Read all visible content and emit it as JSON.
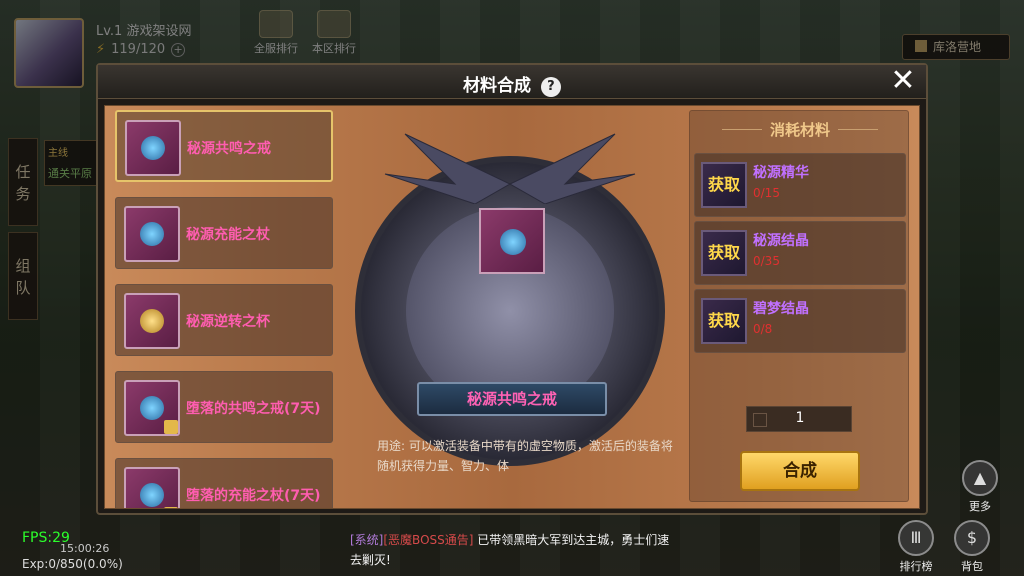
{
  "hud": {
    "level": "Lv.1",
    "player_name": "游戏架设网",
    "stamina": "119/120",
    "plus": "+",
    "rank_all": "全服排行",
    "rank_zone": "本区排行",
    "location": "库洛营地",
    "side_tab_task": "任务",
    "side_tab_team": "组队",
    "quest_tag": "主线",
    "quest_text": "通关平原",
    "fps": "FPS:29",
    "clock": "15:00:26",
    "exp": "Exp:0/850(0.0%)",
    "more": "更多",
    "ranking": "排行榜",
    "bag": "背包"
  },
  "chat": {
    "tag_system": "[系统]",
    "tag_boss": "[恶魔BOSS通告]",
    "message": "已带领黑暗大军到达主城，勇士们速去剿灭!"
  },
  "dialog": {
    "title": "材料合成",
    "help": "?",
    "close": "✕",
    "recipes": [
      {
        "name": "秘源共鸣之戒",
        "selected": true,
        "locked": false,
        "icon": "ring-icon"
      },
      {
        "name": "秘源充能之杖",
        "selected": false,
        "locked": false,
        "icon": "staff-icon"
      },
      {
        "name": "秘源逆转之杯",
        "selected": false,
        "locked": false,
        "icon": "cup-icon"
      },
      {
        "name": "堕落的共鸣之戒(7天)",
        "selected": false,
        "locked": true,
        "icon": "ring-icon"
      },
      {
        "name": "堕落的充能之杖(7天)",
        "selected": false,
        "locked": true,
        "icon": "staff-icon"
      }
    ],
    "selected_item_name": "秘源共鸣之戒",
    "description": "用途: 可以激活装备中带有的虚空物质，激活后的装备将随机获得力量、智力、体",
    "materials_title": "消耗材料",
    "materials": [
      {
        "get_label": "获取",
        "name": "秘源精华",
        "count": "0/15"
      },
      {
        "get_label": "获取",
        "name": "秘源结晶",
        "count": "0/35"
      },
      {
        "get_label": "获取",
        "name": "碧梦结晶",
        "count": "0/8"
      }
    ],
    "quantity": "1",
    "synthesize_label": "合成"
  }
}
